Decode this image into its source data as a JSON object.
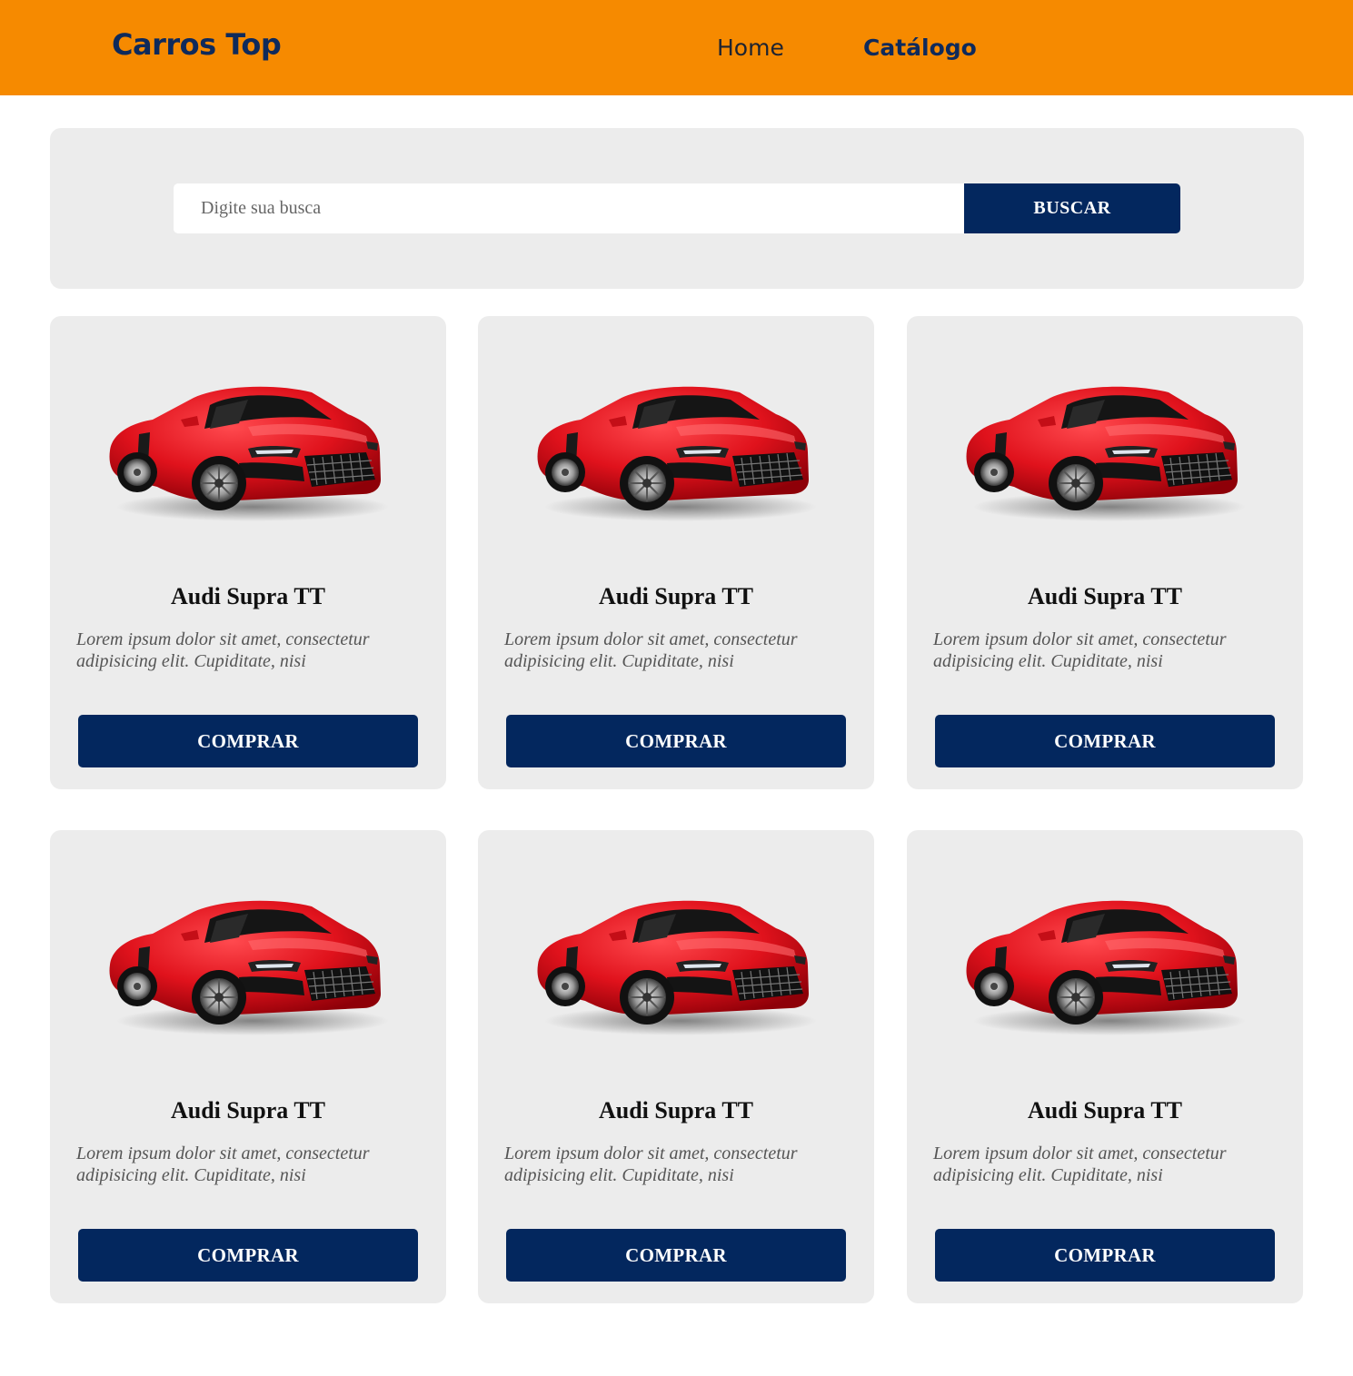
{
  "header": {
    "brand": "Carros Top",
    "nav": [
      {
        "label": "Home"
      },
      {
        "label": "Catálogo"
      }
    ]
  },
  "search": {
    "placeholder": "Digite sua busca",
    "value": "",
    "button_label": "BUSCAR"
  },
  "colors": {
    "header_bg": "#F68A00",
    "brand": "#0F2A5B",
    "button_bg": "#03275E",
    "panel_bg": "#ECECEC",
    "car_body": "#E0121C"
  },
  "products": [
    {
      "title": "Audi Supra TT",
      "description": "Lorem ipsum dolor sit amet, consectetur adipisicing elit. Cupiditate, nisi",
      "button_label": "COMPRAR",
      "image": "red-sports-car"
    },
    {
      "title": "Audi Supra TT",
      "description": "Lorem ipsum dolor sit amet, consectetur adipisicing elit. Cupiditate, nisi",
      "button_label": "COMPRAR",
      "image": "red-sports-car"
    },
    {
      "title": "Audi Supra TT",
      "description": "Lorem ipsum dolor sit amet, consectetur adipisicing elit. Cupiditate, nisi",
      "button_label": "COMPRAR",
      "image": "red-sports-car"
    },
    {
      "title": "Audi Supra TT",
      "description": "Lorem ipsum dolor sit amet, consectetur adipisicing elit. Cupiditate, nisi",
      "button_label": "COMPRAR",
      "image": "red-sports-car"
    },
    {
      "title": "Audi Supra TT",
      "description": "Lorem ipsum dolor sit amet, consectetur adipisicing elit. Cupiditate, nisi",
      "button_label": "COMPRAR",
      "image": "red-sports-car"
    },
    {
      "title": "Audi Supra TT",
      "description": "Lorem ipsum dolor sit amet, consectetur adipisicing elit. Cupiditate, nisi",
      "button_label": "COMPRAR",
      "image": "red-sports-car"
    }
  ]
}
